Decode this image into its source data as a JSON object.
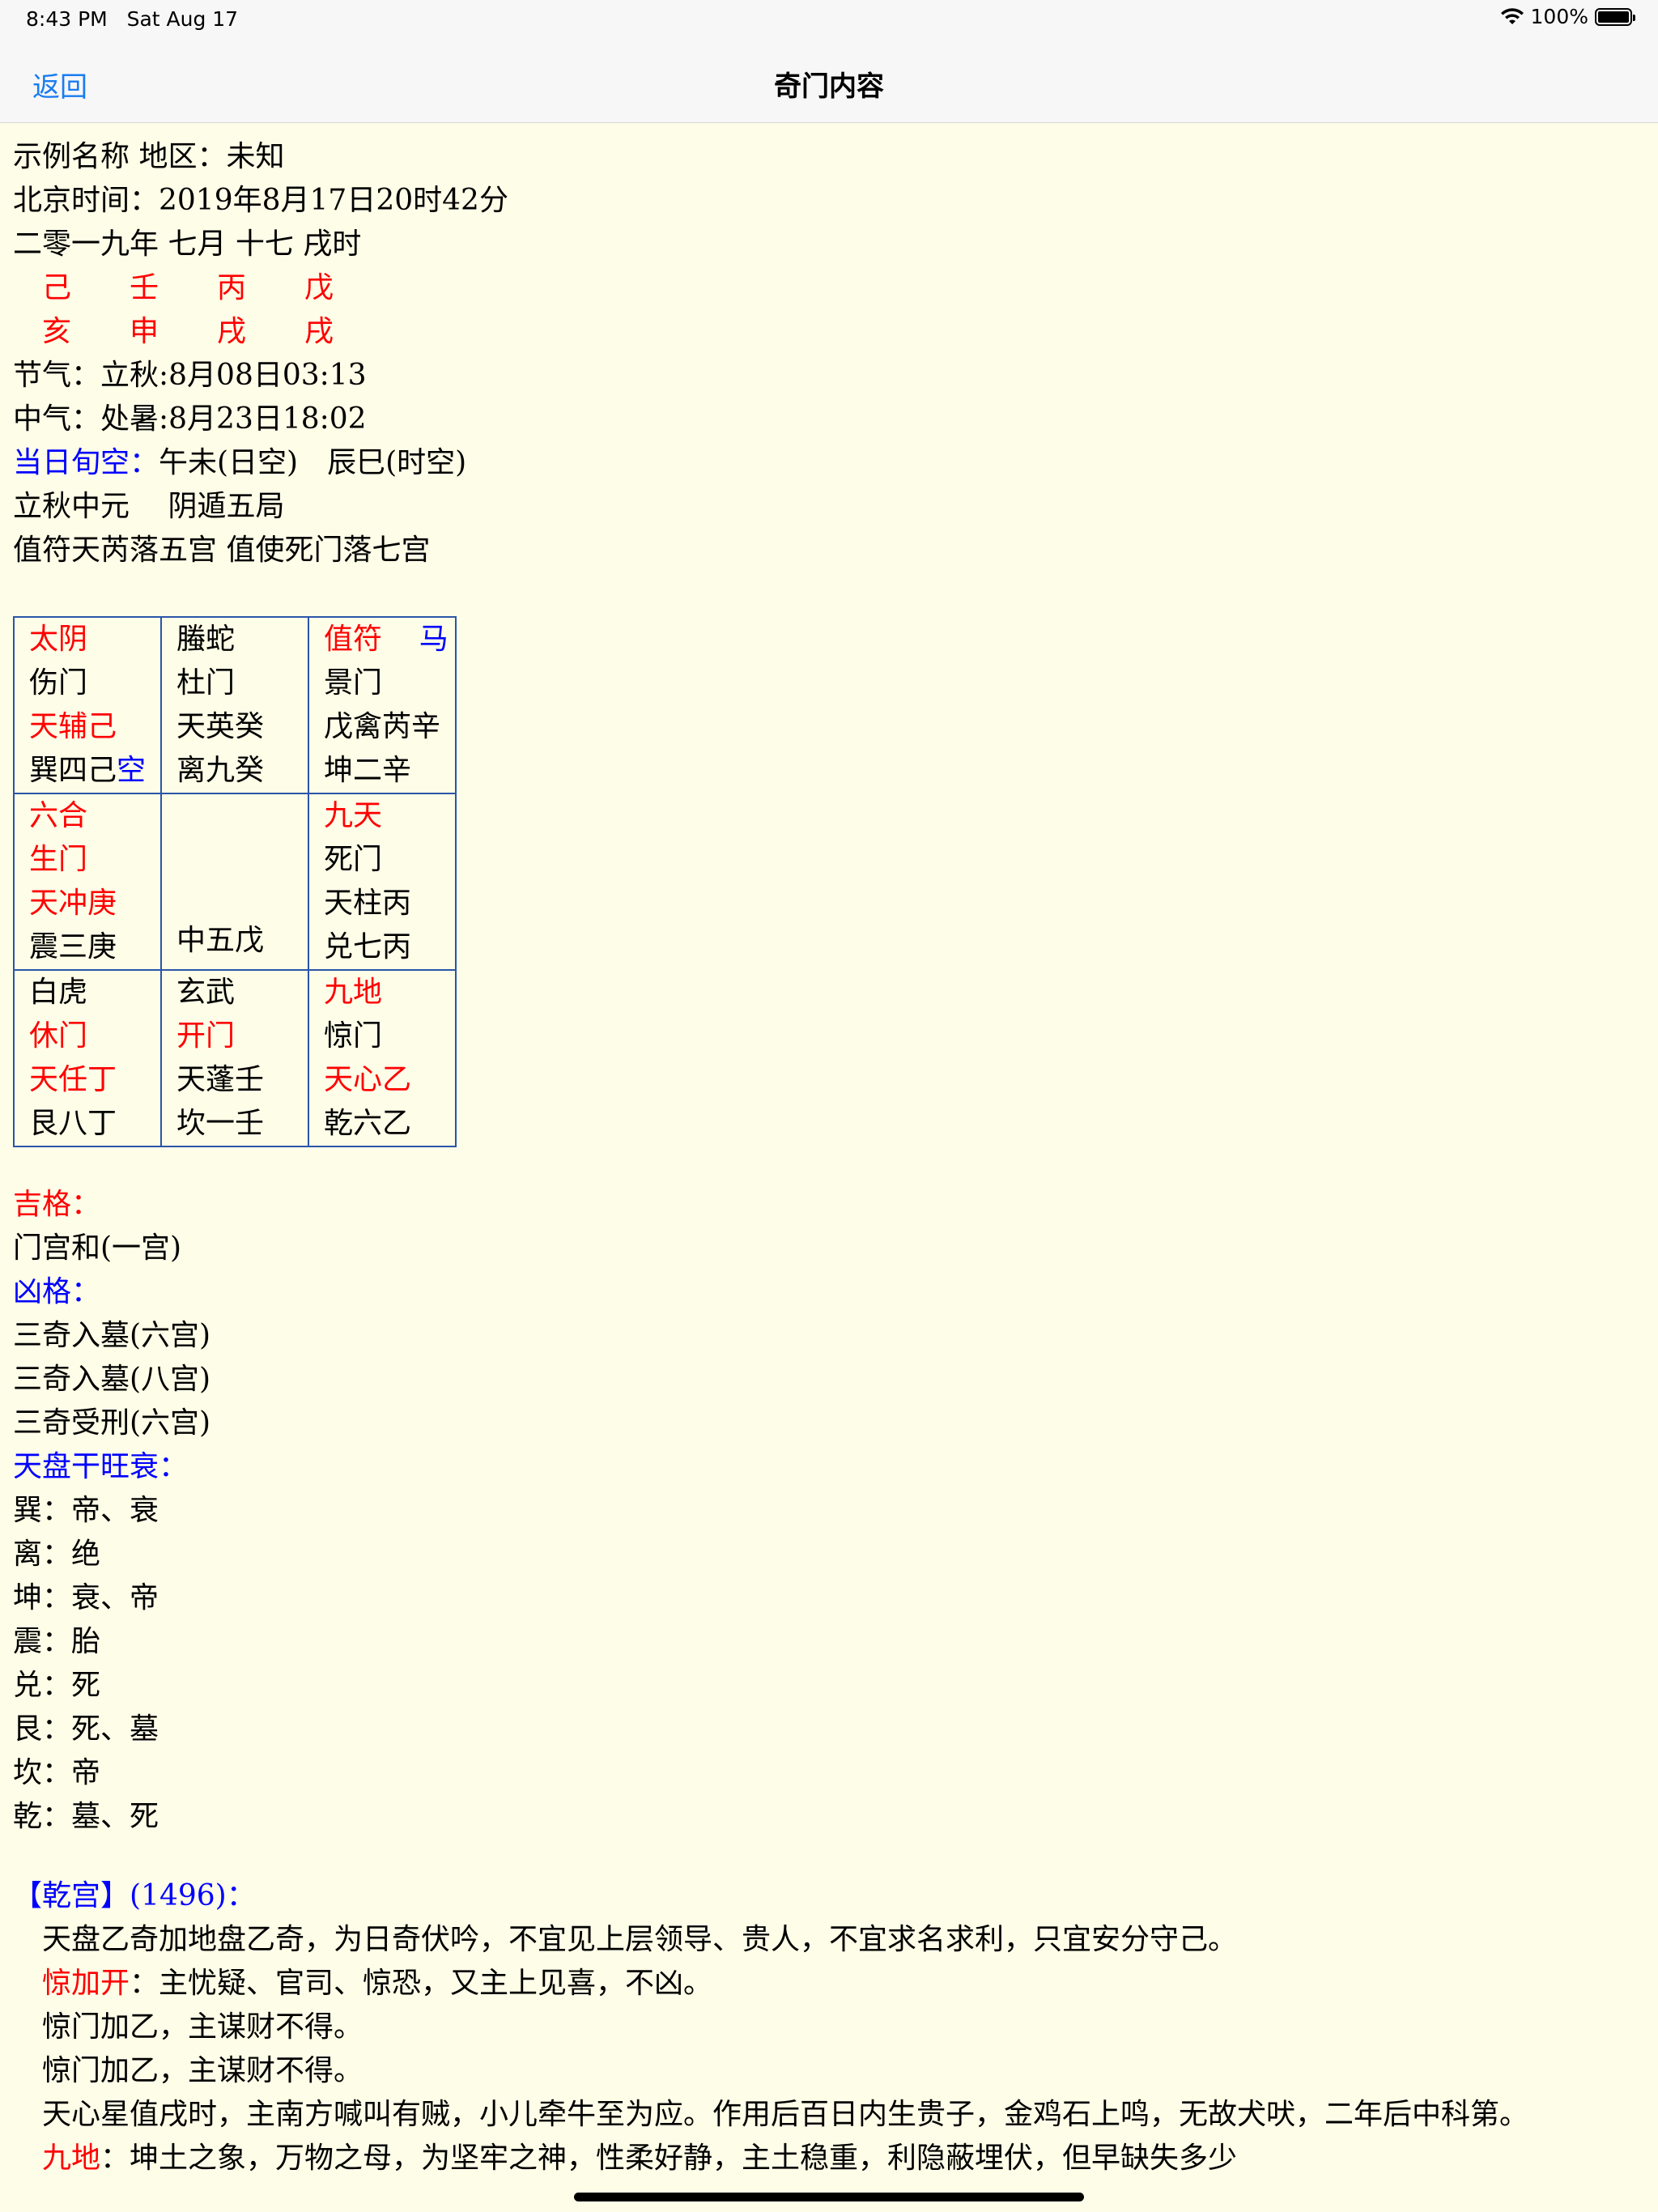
{
  "status": {
    "time": "8:43 PM",
    "date": "Sat Aug 17",
    "battery": "100%",
    "battery_level": 1.0
  },
  "nav": {
    "back": "返回",
    "title": "奇门内容"
  },
  "info": {
    "l1": "示例名称 地区：未知",
    "l2": "北京时间：2019年8月17日20时42分",
    "l3": "二零一九年 七月 十七 戌时",
    "gan": [
      "己",
      "壬",
      "丙",
      "戊"
    ],
    "zhi": [
      "亥",
      "申",
      "戌",
      "戌"
    ],
    "jieqi": "节气：立秋:8月08日03:13",
    "zhongqi": "中气：处暑:8月23日18:02",
    "xunkong_label": "当日旬空：",
    "xunkong_value": "午未(日空)　辰巳(时空)",
    "ju": "立秋中元　 阴遁五局",
    "zhifu": "值符天芮落五宫 值使死门落七宫"
  },
  "palaces": {
    "r0c0": {
      "a": "太阴",
      "b": "伤门",
      "c": "天辅己",
      "d1": "巽四己",
      "d2": "空"
    },
    "r0c1": {
      "a": "螣蛇",
      "b": "杜门",
      "c": "天英癸",
      "d": "离九癸"
    },
    "r0c2": {
      "a": "值符",
      "a2": "马",
      "b": "景门",
      "c": "戊禽芮辛",
      "d": "坤二辛"
    },
    "r1c0": {
      "a": "六合",
      "b": "生门",
      "c": "天冲庚",
      "d": "震三庚"
    },
    "r1c1": {
      "d": "中五戊"
    },
    "r1c2": {
      "a": "九天",
      "b": "死门",
      "c": "天柱丙",
      "d": "兑七丙"
    },
    "r2c0": {
      "a": "白虎",
      "b": "休门",
      "c": "天任丁",
      "d": "艮八丁"
    },
    "r2c1": {
      "a": "玄武",
      "b": "开门",
      "c": "天蓬壬",
      "d": "坎一壬"
    },
    "r2c2": {
      "a": "九地",
      "b": "惊门",
      "c": "天心乙",
      "d": "乾六乙"
    }
  },
  "ji": {
    "label": "吉格：",
    "items": [
      "门宫和(一宫)"
    ]
  },
  "xiong": {
    "label": "凶格：",
    "items": [
      "三奇入墓(六宫)",
      "三奇入墓(八宫)",
      "三奇受刑(六宫)"
    ]
  },
  "wangshuai": {
    "label": "天盘干旺衰：",
    "items": [
      "巽：帝、衰",
      "离：绝",
      "坤：衰、帝",
      "震：胎",
      "兑：死",
      "艮：死、墓",
      "坎：帝",
      "乾：墓、死"
    ]
  },
  "qian": {
    "title": "【乾宫】",
    "count": "(1496)：",
    "l1": "天盘乙奇加地盘乙奇，为日奇伏吟，不宜见上层领导、贵人，不宜求名求利，只宜安分守己。",
    "l2_red": "惊加开",
    "l2": "：主忧疑、官司、惊恐，又主上见喜，不凶。",
    "l3": "惊门加乙，主谋财不得。",
    "l4": "惊门加乙，主谋财不得。",
    "l5": "天心星值戌时，主南方喊叫有贼，小儿牵牛至为应。作用后百日内生贵子，金鸡石上鸣，无故犬吠，二年后中科第。",
    "l6_red": "九地",
    "l6": "：坤土之象，万物之母，为坚牢之神，性柔好静，主土稳重，利隐蔽埋伏，但早缺失多少"
  }
}
